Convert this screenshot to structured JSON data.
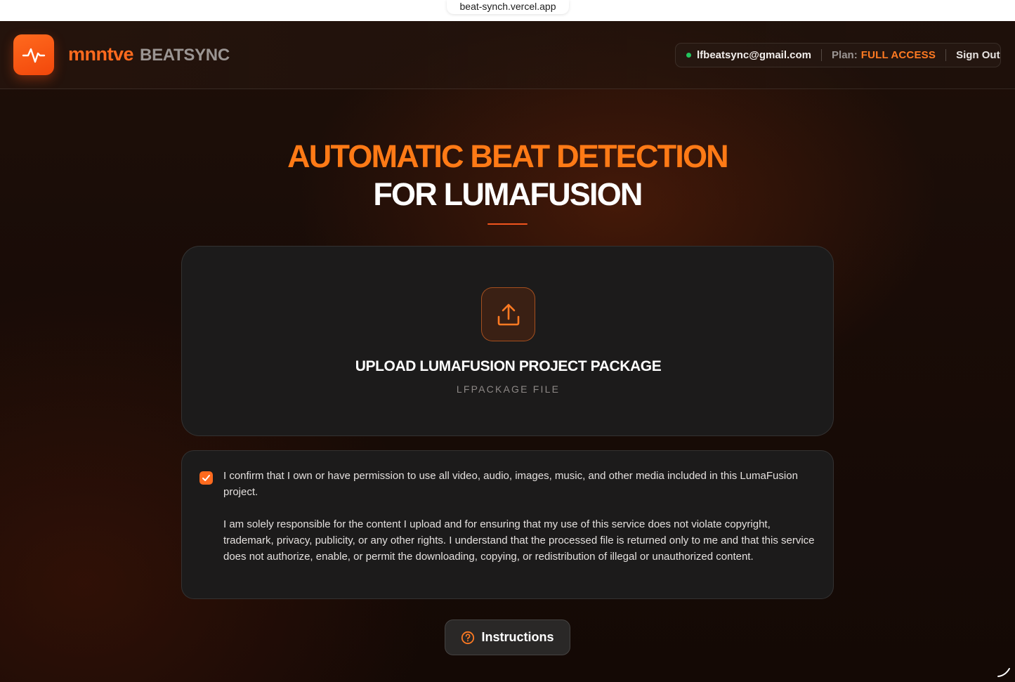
{
  "browser": {
    "url": "beat-synch.vercel.app"
  },
  "header": {
    "logo_icon": "pulse-waveform-icon",
    "brand_main": "mnntve",
    "brand_sub": "BEATSYNC",
    "account": {
      "email": "lfbeatsync@gmail.com",
      "plan_label": "Plan:",
      "plan_value": "FULL ACCESS",
      "sign_out_label": "Sign Out",
      "status": "online"
    }
  },
  "hero": {
    "line1": "AUTOMATIC BEAT DETECTION",
    "line2": "FOR LUMAFUSION"
  },
  "upload": {
    "icon": "upload-tray-icon",
    "title": "UPLOAD LUMAFUSION PROJECT PACKAGE",
    "subtitle": "LFPACKAGE FILE"
  },
  "consent": {
    "checked": true,
    "paragraph1": "I confirm that I own or have permission to use all video, audio, images, music, and other media included in this LumaFusion project.",
    "paragraph2": "I am solely responsible for the content I upload and for ensuring that my use of this service does not violate copyright, trademark, privacy, publicity, or any other rights. I understand that the processed file is returned only to me and that this service does not authorize, enable, or permit the downloading, copying, or redistribution of illegal or unauthorized content."
  },
  "instructions": {
    "icon": "question-circle-icon",
    "label": "Instructions"
  },
  "colors": {
    "accent": "#ff6a1e",
    "accent_text": "#ff7a16",
    "status_online": "#22c55e",
    "card_bg": "#1c1b1b",
    "page_bg": "#190c07"
  }
}
